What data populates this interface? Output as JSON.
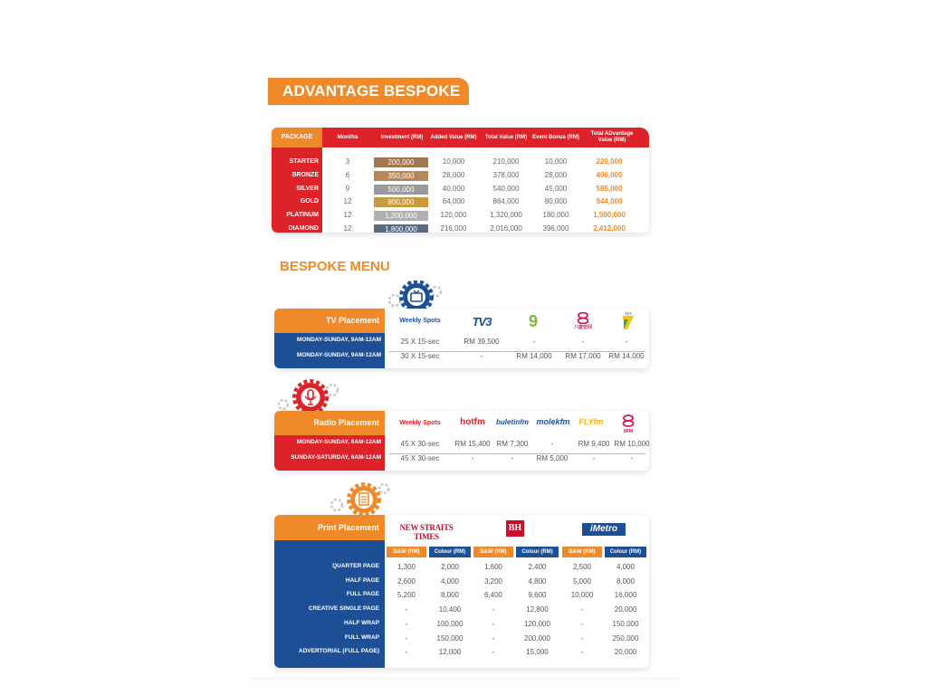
{
  "title": "ADVANTAGE BESPOKE",
  "package_table": {
    "headers": [
      "PACKAGE",
      "Months",
      "Investment (RM)",
      "Added Value (RM)",
      "Total Value (RM)",
      "Event Bonus (RM)",
      "Total ADvantage Value (RM)"
    ],
    "rows": [
      {
        "name": "STARTER",
        "months": "3",
        "investment": "200,000",
        "added": "10,000",
        "total": "210,000",
        "bonus": "10,000",
        "adv": "220,000",
        "color": "#a0784f"
      },
      {
        "name": "BRONZE",
        "months": "6",
        "investment": "350,000",
        "added": "28,000",
        "total": "378,000",
        "bonus": "28,000",
        "adv": "406,000",
        "color": "#b8865a"
      },
      {
        "name": "SILVER",
        "months": "9",
        "investment": "500,000",
        "added": "40,000",
        "total": "540,000",
        "bonus": "45,000",
        "adv": "585,000",
        "color": "#9a9a9a"
      },
      {
        "name": "GOLD",
        "months": "12",
        "investment": "800,000",
        "added": "64,000",
        "total": "864,000",
        "bonus": "80,000",
        "adv": "944,000",
        "color": "#c79a3c"
      },
      {
        "name": "PLATINUM",
        "months": "12",
        "investment": "1,200,000",
        "added": "120,000",
        "total": "1,320,000",
        "bonus": "180,000",
        "adv": "1,500,000",
        "color": "#b0b0b0"
      },
      {
        "name": "DIAMOND",
        "months": "12",
        "investment": "1,800,000",
        "added": "216,000",
        "total": "2,016,000",
        "bonus": "396,000",
        "adv": "2,412,000",
        "color": "#5a6b80"
      }
    ]
  },
  "bespoke_menu": "BESPOKE MENU",
  "tv": {
    "label": "TV Placement",
    "weekly": "Weekly Spots",
    "channels": [
      "TV3",
      "9",
      "八度空间",
      "TV7"
    ],
    "rows": [
      {
        "slot": "MONDAY-SUNDAY, 9AM-12AM",
        "spots": "25 X 15-sec",
        "values": [
          "RM 39,500",
          "-",
          "-",
          "-"
        ]
      },
      {
        "slot": "MONDAY-SUNDAY, 9AM-12AM",
        "spots": "30 X 15-sec",
        "values": [
          "-",
          "RM 14,000",
          "RM 17,000",
          "RM 14,000"
        ]
      }
    ]
  },
  "radio": {
    "label": "Radio Placement",
    "weekly": "Weekly Spots",
    "stations": [
      "hotfm",
      "buletinfm",
      "molekfm",
      "FLYfm",
      "8FM"
    ],
    "rows": [
      {
        "slot": "MONDAY-SUNDAY, 6AM-12AM",
        "spots": "45 X 30-sec",
        "values": [
          "RM 15,400",
          "RM 7,300",
          "-",
          "RM 9,400",
          "RM 10,000"
        ]
      },
      {
        "slot": "SUNDAY-SATURDAY, 6AM-12AM",
        "spots": "45 X 30-sec",
        "values": [
          "-",
          "-",
          "RM 5,000",
          "-",
          "-"
        ]
      }
    ]
  },
  "print": {
    "label": "Print Placement",
    "papers": [
      "NEW STRAITS TIMES",
      "BH",
      "iMetro"
    ],
    "subheads": [
      "B&W (RM)",
      "Colour (RM)",
      "B&W (RM)",
      "Colour (RM)",
      "B&W (RM)",
      "Colour (RM)"
    ],
    "rows": [
      {
        "name": "QUARTER PAGE",
        "values": [
          "1,300",
          "2,000",
          "1,600",
          "2,400",
          "2,500",
          "4,000"
        ]
      },
      {
        "name": "HALF PAGE",
        "values": [
          "2,600",
          "4,000",
          "3,200",
          "4,800",
          "5,000",
          "8,000"
        ]
      },
      {
        "name": "FULL PAGE",
        "values": [
          "5,200",
          "8,000",
          "6,400",
          "9,600",
          "10,000",
          "16,000"
        ]
      },
      {
        "name": "CREATIVE SINGLE PAGE",
        "values": [
          "-",
          "10,400",
          "-",
          "12,800",
          "-",
          "20,000"
        ]
      },
      {
        "name": "HALF WRAP",
        "values": [
          "-",
          "100,000",
          "-",
          "120,000",
          "-",
          "150,000"
        ]
      },
      {
        "name": "FULL WRAP",
        "values": [
          "-",
          "150,000",
          "-",
          "200,000",
          "-",
          "250,000"
        ]
      },
      {
        "name": "ADVERTORIAL (FULL PAGE)",
        "values": [
          "-",
          "12,000",
          "-",
          "15,000",
          "-",
          "20,000"
        ]
      }
    ]
  },
  "colors": {
    "orange": "#ee8a2a",
    "red": "#dd2229",
    "blue": "#1c4f96"
  }
}
